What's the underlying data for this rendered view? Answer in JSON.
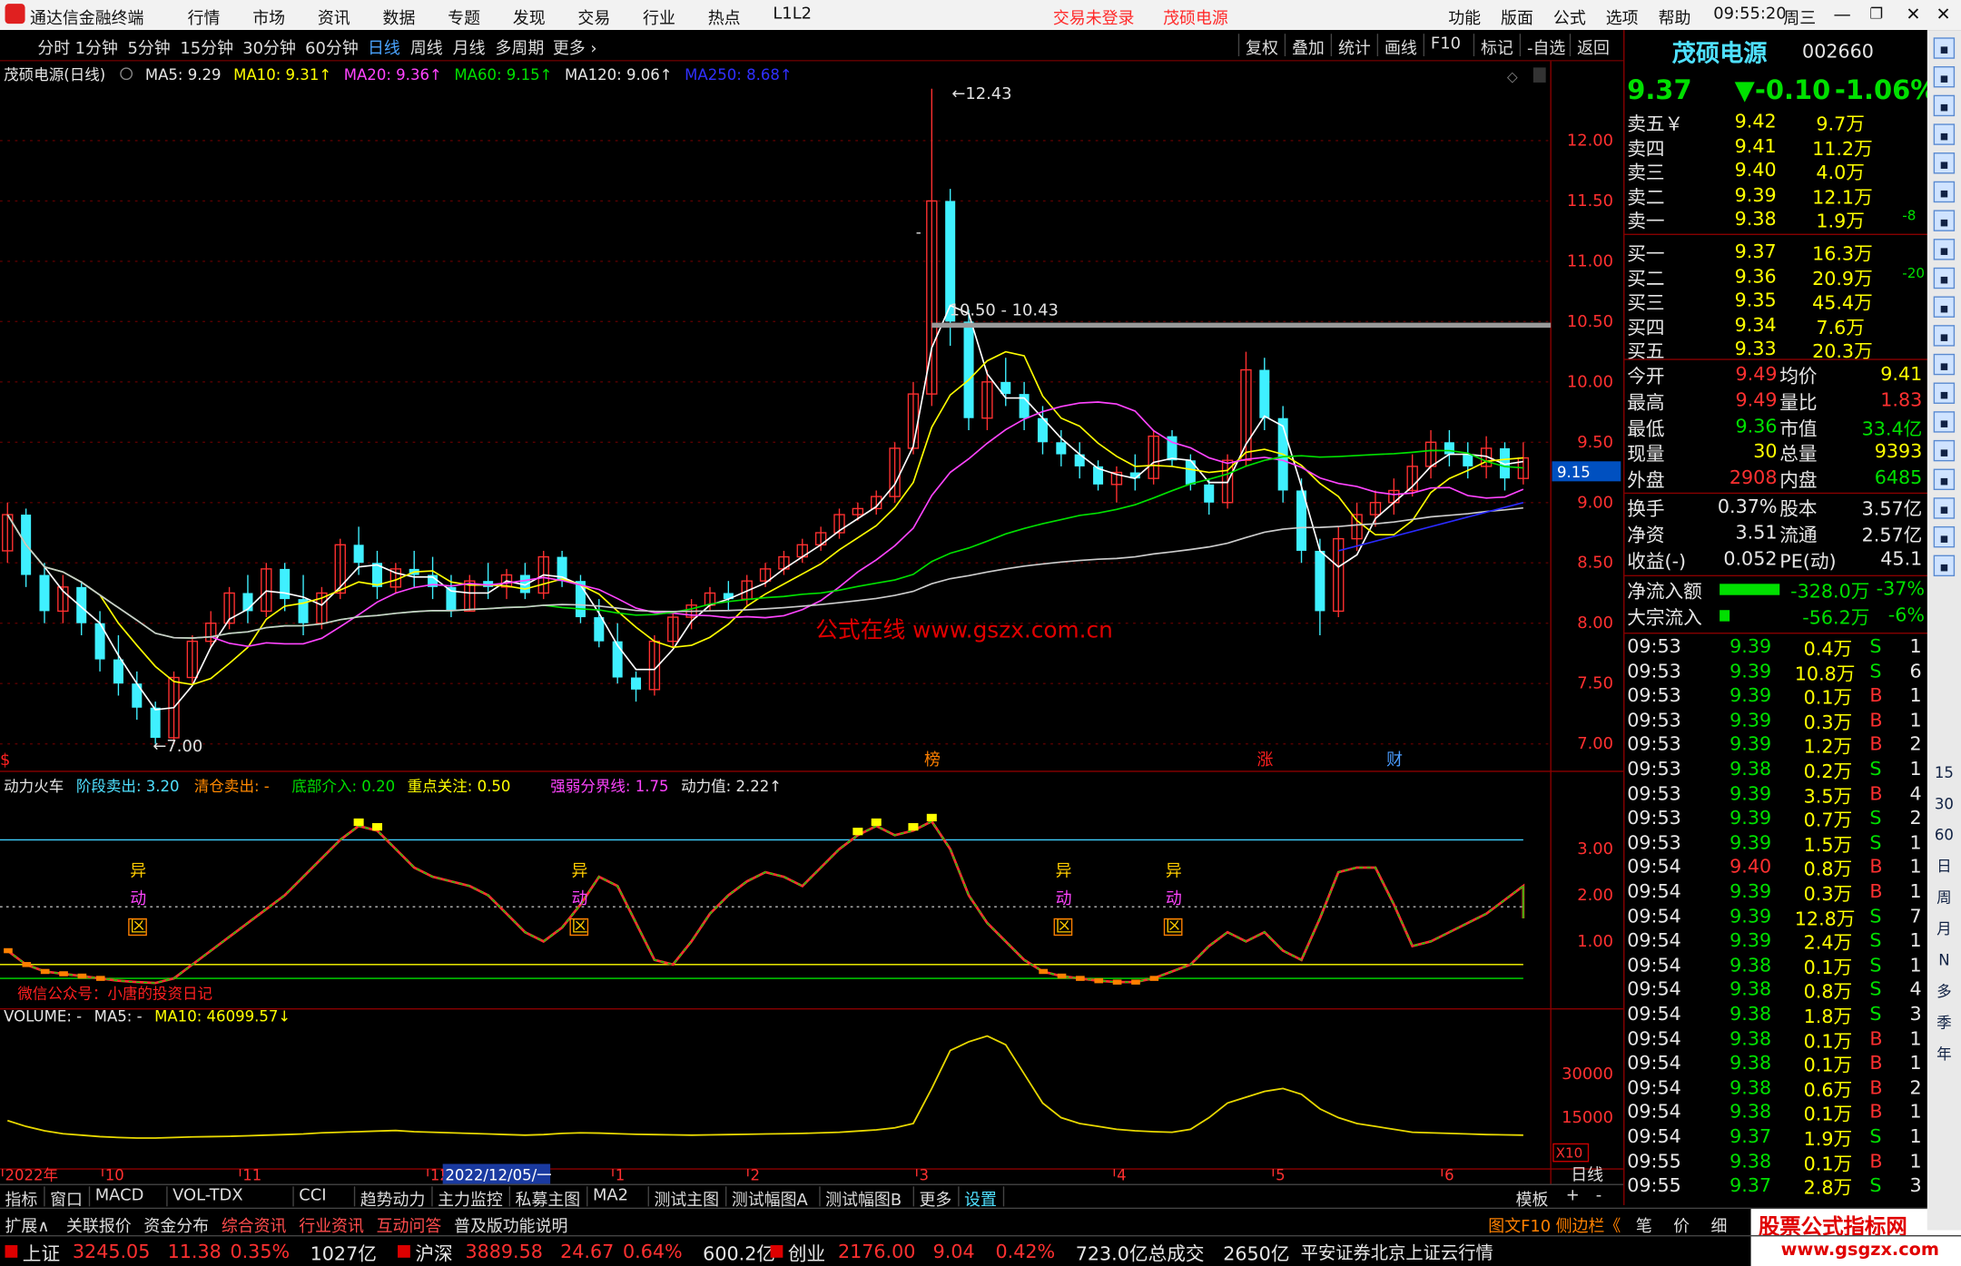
{
  "app": {
    "title": "通达信金融终端",
    "time": "09:55:20",
    "weekday": "周三",
    "menu": [
      "行情",
      "市场",
      "资讯",
      "数据",
      "专题",
      "发现",
      "交易",
      "行业",
      "热点",
      "L1L2"
    ],
    "trade_status": "交易未登录",
    "stock_link": "茂硕电源",
    "right_menu": [
      "功能",
      "版面",
      "公式",
      "选项",
      "帮助"
    ]
  },
  "periods": [
    "分时",
    "1分钟",
    "5分钟",
    "15分钟",
    "30分钟",
    "60分钟",
    "日线",
    "周线",
    "月线",
    "多周期",
    "更多"
  ],
  "selected_period": "日线",
  "chart_tools": [
    "复权",
    "叠加",
    "统计",
    "画线",
    "F10",
    "标记",
    "-自选",
    "返回"
  ],
  "main_legend": {
    "name": "茂硕电源(日线)",
    "ma5": "MA5: 9.29",
    "ma10": "MA10: 9.31↑",
    "ma20": "MA20: 9.36↑",
    "ma60": "MA60: 9.15↑",
    "ma120": "MA120: 9.06↑",
    "ma250": "MA250: 8.68↑"
  },
  "price_axis": [
    "12.00",
    "11.50",
    "11.00",
    "10.50",
    "10.00",
    "9.50",
    "9.00",
    "8.50",
    "8.00",
    "7.50",
    "7.00"
  ],
  "price_tag": "9.15",
  "annotations": {
    "high": "12.43",
    "low": "7.00",
    "range": "10.50 - 10.43",
    "watermark": "公式在线  www.gszx.com.cn",
    "dash": "-"
  },
  "event_marks": [
    "榜",
    "涨",
    "财",
    "$"
  ],
  "ind1_legend": {
    "name": "动力火车",
    "a": "阶段卖出: 3.20",
    "b": "清仓卖出: -",
    "c": "底部介入: 0.20",
    "d": "重点关注: 0.50",
    "e": "强弱分界线: 1.75",
    "f": "动力值: 2.22↑"
  },
  "ind1_axis": [
    "3.00",
    "2.00",
    "1.00"
  ],
  "ind1_text": "微信公众号：小唐的投资日记",
  "yidong": [
    "异",
    "动",
    "区"
  ],
  "vol_legend": {
    "name": "VOLUME: -",
    "ma5": "MA5: -",
    "ma10": "MA10: 46099.57↓"
  },
  "vol_axis": [
    "30000",
    "15000"
  ],
  "vol_unit": "X10",
  "time_axis": [
    "2022年",
    "10",
    "11",
    "12",
    "2022/12/05/一",
    "1",
    "2",
    "3",
    "4",
    "5",
    "6"
  ],
  "time_unit": "日线",
  "bottom_tabs": [
    "指标",
    "窗口",
    "MACD",
    "VOL-TDX",
    "CCI",
    "趋势动力",
    "主力监控",
    "私募主图",
    "MA2",
    "测试主图",
    "测试幅图A",
    "测试幅图B",
    "更多",
    "设置"
  ],
  "bottom_right": [
    "模板",
    "+",
    "-"
  ],
  "bottom2_tabs": [
    "扩展∧",
    "关联报价",
    "资金分布",
    "综合资讯",
    "行业资讯",
    "互动问答",
    "普及版功能说明"
  ],
  "bottom2_right": [
    "图文F10",
    "侧边栏《",
    "笔",
    "价",
    "细"
  ],
  "quote": {
    "name": "茂硕电源",
    "code": "002660",
    "price": "9.37",
    "change": "▼-0.10",
    "pct": "-1.06%",
    "asks": [
      [
        "卖五￥",
        "9.42",
        "9.7万",
        ""
      ],
      [
        "卖四",
        "9.41",
        "11.2万",
        ""
      ],
      [
        "卖三",
        "9.40",
        "4.0万",
        ""
      ],
      [
        "卖二",
        "9.39",
        "12.1万",
        ""
      ],
      [
        "卖一",
        "9.38",
        "1.9万",
        "-8"
      ]
    ],
    "bids": [
      [
        "买一",
        "9.37",
        "16.3万",
        ""
      ],
      [
        "买二",
        "9.36",
        "20.9万",
        "-20"
      ],
      [
        "买三",
        "9.35",
        "45.4万",
        ""
      ],
      [
        "买四",
        "9.34",
        "7.6万",
        ""
      ],
      [
        "买五",
        "9.33",
        "20.3万",
        ""
      ]
    ],
    "stats1": [
      [
        "今开",
        "9.49",
        "均价",
        "9.41"
      ],
      [
        "最高",
        "9.49",
        "量比",
        "1.83"
      ],
      [
        "最低",
        "9.36",
        "市值",
        "33.4亿"
      ],
      [
        "现量",
        "30",
        "总量",
        "9393"
      ],
      [
        "外盘",
        "2908",
        "内盘",
        "6485"
      ]
    ],
    "stats2": [
      [
        "换手",
        "0.37%",
        "股本",
        "3.57亿"
      ],
      [
        "净资",
        "3.51",
        "流通",
        "2.57亿"
      ],
      [
        "收益(-)",
        "0.052",
        "PE(动)",
        "45.1"
      ]
    ],
    "flows": [
      [
        "净流入额",
        "-328.0万",
        "-37%"
      ],
      [
        "大宗流入",
        "-56.2万",
        "-6%"
      ]
    ],
    "ticks": [
      [
        "09:53",
        "9.39",
        "0.4万",
        "S",
        "1"
      ],
      [
        "09:53",
        "9.39",
        "10.8万",
        "S",
        "6"
      ],
      [
        "09:53",
        "9.39",
        "0.1万",
        "B",
        "1"
      ],
      [
        "09:53",
        "9.39",
        "0.3万",
        "B",
        "1"
      ],
      [
        "09:53",
        "9.39",
        "1.2万",
        "B",
        "2"
      ],
      [
        "09:53",
        "9.38",
        "0.2万",
        "S",
        "1"
      ],
      [
        "09:53",
        "9.39",
        "3.5万",
        "B",
        "4"
      ],
      [
        "09:53",
        "9.39",
        "0.7万",
        "S",
        "2"
      ],
      [
        "09:53",
        "9.39",
        "1.5万",
        "S",
        "1"
      ],
      [
        "09:54",
        "9.40",
        "0.8万",
        "B",
        "1"
      ],
      [
        "09:54",
        "9.39",
        "0.3万",
        "B",
        "1"
      ],
      [
        "09:54",
        "9.39",
        "12.8万",
        "S",
        "7"
      ],
      [
        "09:54",
        "9.39",
        "2.4万",
        "S",
        "1"
      ],
      [
        "09:54",
        "9.38",
        "0.1万",
        "S",
        "1"
      ],
      [
        "09:54",
        "9.38",
        "0.8万",
        "S",
        "4"
      ],
      [
        "09:54",
        "9.38",
        "1.8万",
        "S",
        "3"
      ],
      [
        "09:54",
        "9.38",
        "0.1万",
        "B",
        "1"
      ],
      [
        "09:54",
        "9.38",
        "0.1万",
        "B",
        "1"
      ],
      [
        "09:54",
        "9.38",
        "0.6万",
        "B",
        "2"
      ],
      [
        "09:54",
        "9.38",
        "0.1万",
        "B",
        "1"
      ],
      [
        "09:54",
        "9.37",
        "1.9万",
        "S",
        "1"
      ],
      [
        "09:55",
        "9.38",
        "0.1万",
        "B",
        "1"
      ],
      [
        "09:55",
        "9.37",
        "2.8万",
        "S",
        "3"
      ]
    ]
  },
  "sidebar_text": [
    "15",
    "30",
    "60",
    "日",
    "周",
    "月",
    "N",
    "多",
    "季",
    "年"
  ],
  "status": [
    [
      "上证",
      "3245.05",
      "11.38",
      "0.35%",
      "1027亿"
    ],
    [
      "沪深",
      "3889.58",
      "24.67",
      "0.64%",
      "600.2亿"
    ],
    [
      "创业",
      "2176.00",
      "9.04",
      "0.42%",
      "723.0亿"
    ]
  ],
  "total_label": "总成交",
  "total_value": "2650亿",
  "broker": "平安证券北京上证云行情",
  "logo_text": "股票公式指标网",
  "logo_url": "www.gsgzx.com",
  "chart_data": {
    "type": "candlestick",
    "ohlc": [
      [
        8.6,
        9.0,
        8.5,
        8.9
      ],
      [
        8.9,
        8.95,
        8.3,
        8.4
      ],
      [
        8.4,
        8.5,
        8.0,
        8.1
      ],
      [
        8.1,
        8.4,
        8.0,
        8.3
      ],
      [
        8.3,
        8.35,
        7.9,
        8.0
      ],
      [
        8.0,
        8.1,
        7.6,
        7.7
      ],
      [
        7.7,
        7.9,
        7.4,
        7.5
      ],
      [
        7.5,
        7.6,
        7.2,
        7.3
      ],
      [
        7.3,
        7.35,
        7.0,
        7.05
      ],
      [
        7.05,
        7.6,
        7.0,
        7.55
      ],
      [
        7.55,
        7.9,
        7.5,
        7.85
      ],
      [
        7.85,
        8.1,
        7.8,
        8.0
      ],
      [
        8.0,
        8.3,
        7.95,
        8.25
      ],
      [
        8.25,
        8.4,
        8.0,
        8.1
      ],
      [
        8.1,
        8.5,
        8.05,
        8.45
      ],
      [
        8.45,
        8.5,
        8.1,
        8.2
      ],
      [
        8.2,
        8.4,
        7.9,
        8.0
      ],
      [
        8.0,
        8.3,
        7.95,
        8.25
      ],
      [
        8.25,
        8.7,
        8.2,
        8.65
      ],
      [
        8.65,
        8.8,
        8.4,
        8.5
      ],
      [
        8.5,
        8.6,
        8.2,
        8.3
      ],
      [
        8.3,
        8.5,
        8.25,
        8.45
      ],
      [
        8.45,
        8.6,
        8.3,
        8.4
      ],
      [
        8.4,
        8.55,
        8.2,
        8.3
      ],
      [
        8.3,
        8.4,
        8.05,
        8.1
      ],
      [
        8.1,
        8.4,
        8.1,
        8.35
      ],
      [
        8.35,
        8.5,
        8.2,
        8.3
      ],
      [
        8.3,
        8.45,
        8.2,
        8.4
      ],
      [
        8.4,
        8.5,
        8.2,
        8.25
      ],
      [
        8.25,
        8.6,
        8.2,
        8.55
      ],
      [
        8.55,
        8.6,
        8.3,
        8.35
      ],
      [
        8.35,
        8.4,
        8.0,
        8.05
      ],
      [
        8.05,
        8.2,
        7.8,
        7.85
      ],
      [
        7.85,
        8.0,
        7.5,
        7.55
      ],
      [
        7.55,
        7.6,
        7.35,
        7.45
      ],
      [
        7.45,
        7.9,
        7.4,
        7.85
      ],
      [
        7.85,
        8.1,
        7.8,
        8.05
      ],
      [
        8.05,
        8.2,
        7.95,
        8.15
      ],
      [
        8.15,
        8.3,
        8.1,
        8.25
      ],
      [
        8.25,
        8.35,
        8.1,
        8.2
      ],
      [
        8.2,
        8.4,
        8.15,
        8.35
      ],
      [
        8.35,
        8.5,
        8.3,
        8.45
      ],
      [
        8.45,
        8.6,
        8.4,
        8.55
      ],
      [
        8.55,
        8.7,
        8.5,
        8.65
      ],
      [
        8.65,
        8.8,
        8.6,
        8.75
      ],
      [
        8.75,
        8.95,
        8.7,
        8.9
      ],
      [
        8.9,
        9.0,
        8.85,
        8.95
      ],
      [
        8.95,
        9.1,
        8.9,
        9.05
      ],
      [
        9.05,
        9.5,
        9.0,
        9.45
      ],
      [
        9.45,
        10.0,
        9.4,
        9.9
      ],
      [
        9.9,
        12.43,
        9.8,
        11.5
      ],
      [
        11.5,
        11.6,
        10.3,
        10.5
      ],
      [
        10.5,
        10.6,
        9.6,
        9.7
      ],
      [
        9.7,
        10.1,
        9.6,
        10.0
      ],
      [
        10.0,
        10.2,
        9.8,
        9.9
      ],
      [
        9.9,
        10.0,
        9.6,
        9.7
      ],
      [
        9.7,
        9.8,
        9.4,
        9.5
      ],
      [
        9.5,
        9.6,
        9.3,
        9.4
      ],
      [
        9.4,
        9.5,
        9.2,
        9.3
      ],
      [
        9.3,
        9.35,
        9.1,
        9.15
      ],
      [
        9.15,
        9.3,
        9.0,
        9.25
      ],
      [
        9.25,
        9.4,
        9.1,
        9.2
      ],
      [
        9.2,
        9.6,
        9.15,
        9.55
      ],
      [
        9.55,
        9.6,
        9.3,
        9.35
      ],
      [
        9.35,
        9.4,
        9.1,
        9.15
      ],
      [
        9.15,
        9.2,
        8.9,
        9.0
      ],
      [
        9.0,
        9.4,
        8.95,
        9.35
      ],
      [
        9.35,
        10.25,
        9.3,
        10.1
      ],
      [
        10.1,
        10.2,
        9.6,
        9.7
      ],
      [
        9.7,
        9.8,
        9.0,
        9.1
      ],
      [
        9.1,
        9.2,
        8.5,
        8.6
      ],
      [
        8.6,
        8.7,
        7.9,
        8.1
      ],
      [
        8.1,
        8.8,
        8.05,
        8.7
      ],
      [
        8.7,
        9.0,
        8.6,
        8.9
      ],
      [
        8.9,
        9.1,
        8.8,
        9.0
      ],
      [
        9.0,
        9.2,
        8.9,
        9.1
      ],
      [
        9.1,
        9.4,
        9.05,
        9.3
      ],
      [
        9.3,
        9.6,
        9.2,
        9.5
      ],
      [
        9.5,
        9.6,
        9.3,
        9.4
      ],
      [
        9.4,
        9.5,
        9.2,
        9.3
      ],
      [
        9.3,
        9.55,
        9.2,
        9.45
      ],
      [
        9.45,
        9.5,
        9.1,
        9.2
      ],
      [
        9.2,
        9.5,
        9.15,
        9.37
      ]
    ],
    "ma250_start": [
      9.0,
      8.6
    ]
  }
}
